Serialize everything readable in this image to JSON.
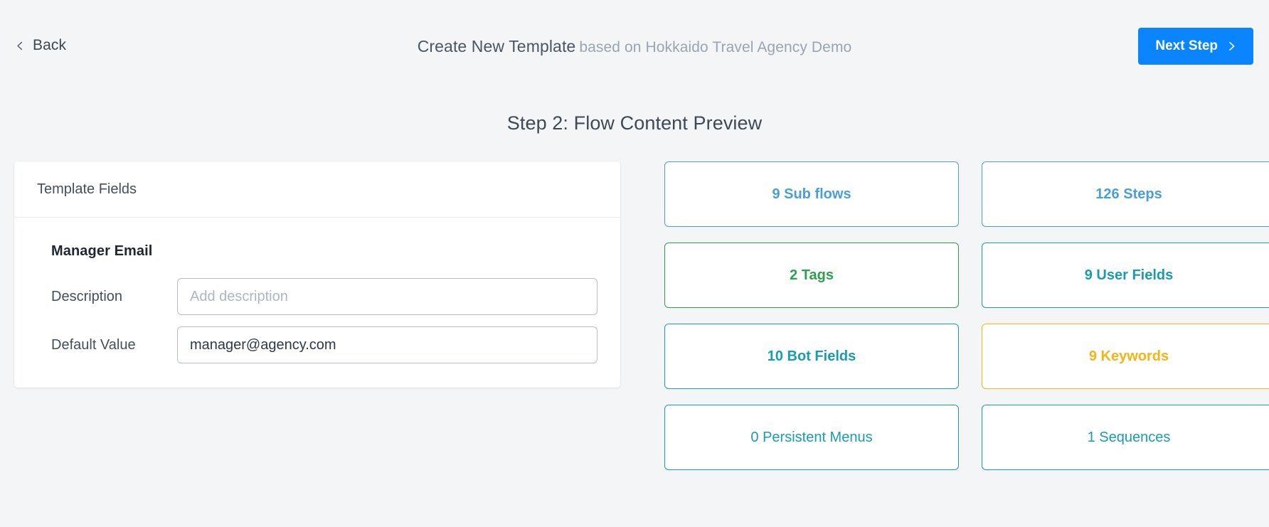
{
  "header": {
    "back_label": "Back",
    "back_icon": "chevron-left-icon",
    "title_main": "Create New Template",
    "title_sub": "based on Hokkaido Travel Agency Demo",
    "next_step_label": "Next Step",
    "next_step_icon": "chevron-right-icon",
    "next_step_color": "#0a84ff"
  },
  "page": {
    "step_heading": "Step 2: Flow Content Preview",
    "background_color": "#f3f5f7"
  },
  "template_fields": {
    "card_title": "Template Fields",
    "group_title": "Manager Email",
    "rows": [
      {
        "label": "Description",
        "value": "",
        "placeholder": "Add description"
      },
      {
        "label": "Default Value",
        "value": "manager@agency.com",
        "placeholder": ""
      }
    ]
  },
  "stats": [
    {
      "label": "9 Sub flows",
      "color": "#4a9fd8",
      "bold": true
    },
    {
      "label": "126 Steps",
      "color": "#4a9fd8",
      "bold": true
    },
    {
      "label": "2 Tags",
      "color": "#2e9e4f",
      "bold": true
    },
    {
      "label": "9 User Fields",
      "color": "#1a9cb0",
      "bold": true
    },
    {
      "label": "10 Bot Fields",
      "color": "#1a9cb0",
      "bold": true
    },
    {
      "label": "9 Keywords",
      "color": "#f5b518",
      "bold": true
    },
    {
      "label": "0 Persistent Menus",
      "color": "#1a9cb0",
      "bold": false
    },
    {
      "label": "1 Sequences",
      "color": "#1a9cb0",
      "bold": false
    }
  ]
}
